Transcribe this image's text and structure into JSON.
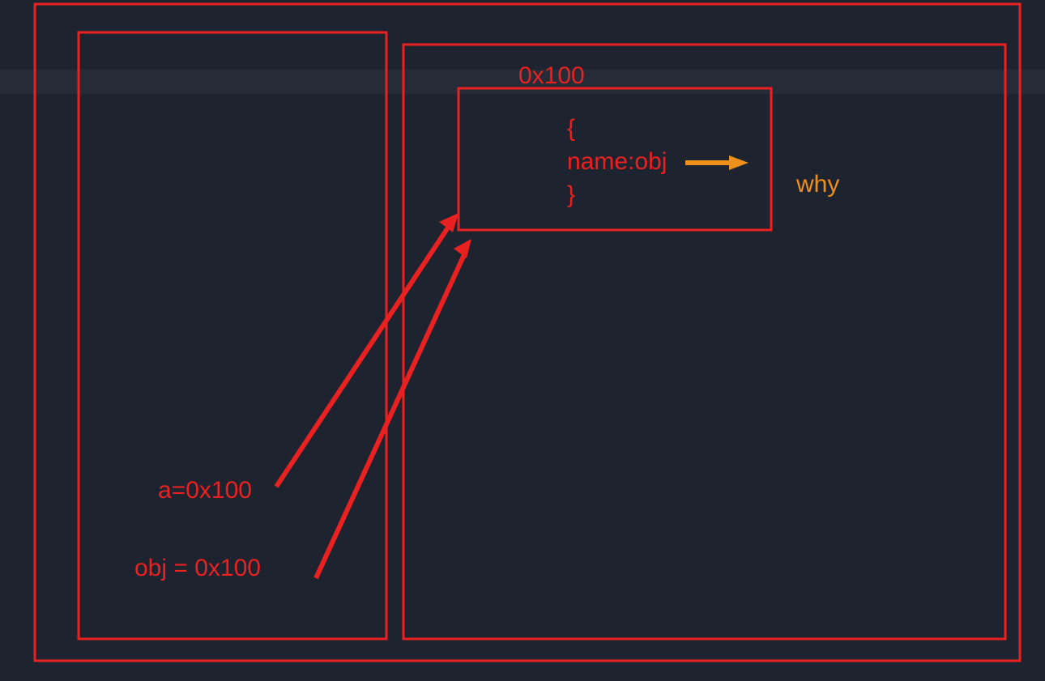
{
  "heap": {
    "address_label": "0x100",
    "object_lines": [
      "{",
      "name:obj",
      "}"
    ]
  },
  "stack": {
    "var_a": "a=0x100",
    "var_obj": "obj = 0x100"
  },
  "annotation": "why"
}
